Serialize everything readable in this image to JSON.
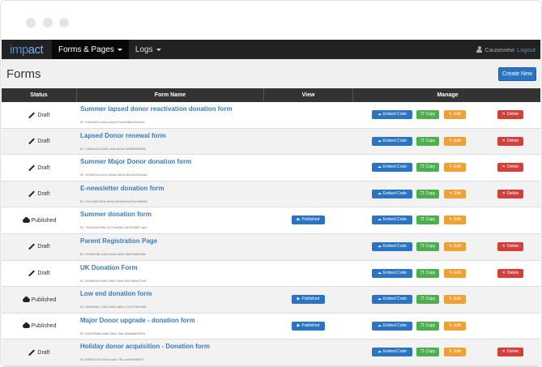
{
  "navbar": {
    "brand_a": "imp",
    "brand_b": "act",
    "menu_forms": "Forms & Pages",
    "menu_logs": "Logs",
    "user": "Causeview",
    "logout": "Logout"
  },
  "page": {
    "title": "Forms",
    "create_button": "Create New"
  },
  "table": {
    "headers": {
      "status": "Status",
      "form_name": "Form Name",
      "view": "View",
      "manage": "Manage"
    },
    "buttons": {
      "view": "Published",
      "embed": "Embed Code",
      "copy": "Copy",
      "edit": "Edit",
      "delete": "Delete"
    },
    "rows": [
      {
        "status": "Draft",
        "name": "Summer lapsed donor reactivation donation form",
        "id": "ID: 4d414f22-ce6d-4ac3-b7cd-b6bfd181e4ec",
        "published": false
      },
      {
        "status": "Draft",
        "name": "Lapsed Donor renewal form",
        "id": "ID: 228eea13-b035-4cdc-8c1d-0e8586b0d6f0",
        "published": false
      },
      {
        "status": "Draft",
        "name": "Summer Major Donor donation form",
        "id": "ID: 3f760e1b-eb14-453de-8600-8c2d37cb6c6c",
        "published": false
      },
      {
        "status": "Draft",
        "name": "E-newsletter donation form",
        "id": "ID: 20c7e8f0-82fe-4b0d-8f13b0cbe22cc3fd656",
        "published": false
      },
      {
        "status": "Published",
        "name": "Summer donation form",
        "id": "ID: 7f91a02b-f86c-4171bd62e-2d12fe5f07 ae6",
        "published": true
      },
      {
        "status": "Draft",
        "name": "Parent Registration Page",
        "id": "ID: 2e0b5048-1de3-4c6a-b0e4-3d676a5f2b5e",
        "published": false
      },
      {
        "status": "Draft",
        "name": "UK Donation Form",
        "id": "ID: 834d5b1e-fbe0-4653-b9a9-4f443e5f670c8",
        "published": false
      },
      {
        "status": "Published",
        "name": "Low end donation form",
        "id": "ID: d5eb2f6e7-2b1f-4431-a82c-17b1f73eb4d8",
        "published": true
      },
      {
        "status": "Published",
        "name": "Major Donor upgrade - donation form",
        "id": "ID: b0a10f6ab-b4a0-46cb-0ab-94a8fa828b7e",
        "published": true
      },
      {
        "status": "Draft",
        "name": "Holiday donor acquisition - Donation form",
        "id": "ID: 830fc517b-6c6d-4a1e-7ff1-aa3c5d36637",
        "published": false
      }
    ]
  }
}
